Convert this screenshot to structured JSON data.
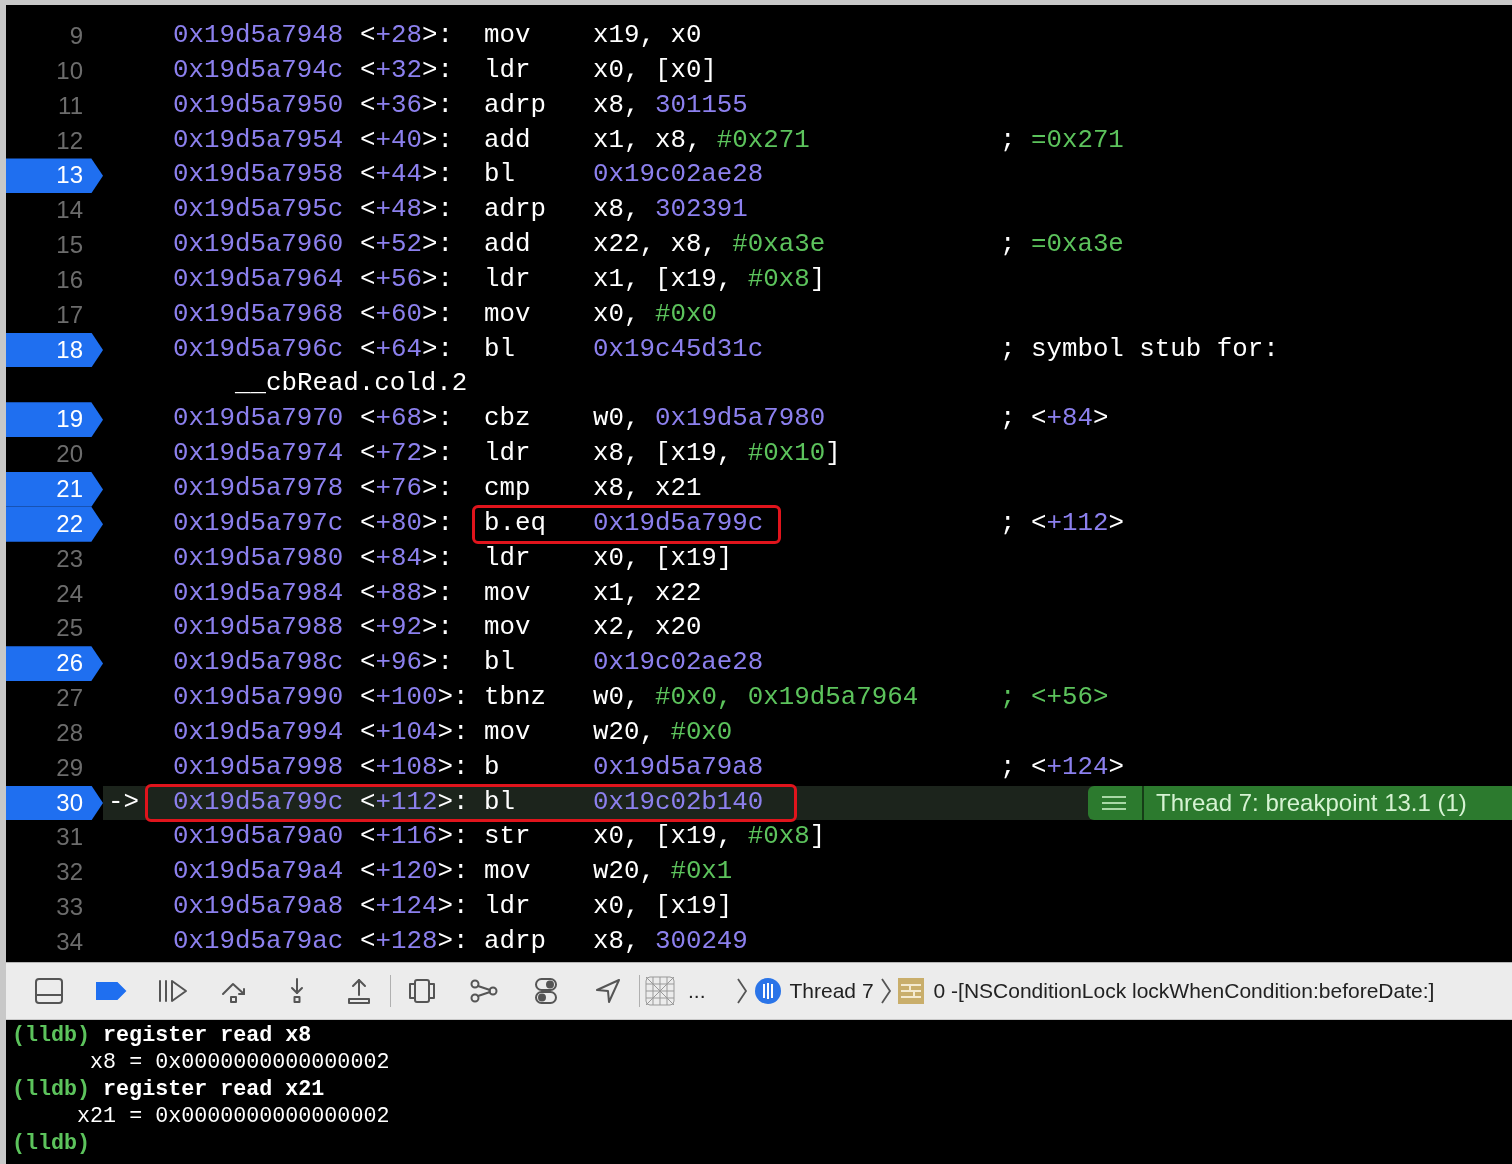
{
  "disassembly": {
    "rows": [
      {
        "line": "9",
        "breakpoint": false,
        "current": false,
        "address": "0x19d5a7948",
        "offset": "<+28>:",
        "mnemonic": "mov",
        "operands": [
          {
            "text": "x19, x0",
            "kind": "reg"
          }
        ]
      },
      {
        "line": "10",
        "breakpoint": false,
        "current": false,
        "address": "0x19d5a794c",
        "offset": "<+32>:",
        "mnemonic": "ldr",
        "operands": [
          {
            "text": "x0, [x0]",
            "kind": "reg"
          }
        ]
      },
      {
        "line": "11",
        "breakpoint": false,
        "current": false,
        "address": "0x19d5a7950",
        "offset": "<+36>:",
        "mnemonic": "adrp",
        "operands": [
          {
            "text": "x8, ",
            "kind": "reg"
          },
          {
            "text": "301155",
            "kind": "addr"
          }
        ]
      },
      {
        "line": "12",
        "breakpoint": false,
        "current": false,
        "address": "0x19d5a7954",
        "offset": "<+40>:",
        "mnemonic": "add",
        "operands": [
          {
            "text": "x1, x8, ",
            "kind": "reg"
          },
          {
            "text": "#0x271",
            "kind": "imm"
          }
        ],
        "comment": [
          {
            "text": "; ",
            "kind": "reg"
          },
          {
            "text": "=0x271",
            "kind": "imm"
          }
        ]
      },
      {
        "line": "13",
        "breakpoint": true,
        "current": false,
        "address": "0x19d5a7958",
        "offset": "<+44>:",
        "mnemonic": "bl",
        "operands": [
          {
            "text": "0x19c02ae28",
            "kind": "addr"
          }
        ]
      },
      {
        "line": "14",
        "breakpoint": false,
        "current": false,
        "address": "0x19d5a795c",
        "offset": "<+48>:",
        "mnemonic": "adrp",
        "operands": [
          {
            "text": "x8, ",
            "kind": "reg"
          },
          {
            "text": "302391",
            "kind": "addr"
          }
        ]
      },
      {
        "line": "15",
        "breakpoint": false,
        "current": false,
        "address": "0x19d5a7960",
        "offset": "<+52>:",
        "mnemonic": "add",
        "operands": [
          {
            "text": "x22, x8, ",
            "kind": "reg"
          },
          {
            "text": "#0xa3e",
            "kind": "imm"
          }
        ],
        "comment": [
          {
            "text": "; ",
            "kind": "reg"
          },
          {
            "text": "=0xa3e",
            "kind": "imm"
          }
        ]
      },
      {
        "line": "16",
        "breakpoint": false,
        "current": false,
        "address": "0x19d5a7964",
        "offset": "<+56>:",
        "mnemonic": "ldr",
        "operands": [
          {
            "text": "x1, [x19, ",
            "kind": "reg"
          },
          {
            "text": "#0x8",
            "kind": "imm"
          },
          {
            "text": "]",
            "kind": "reg"
          }
        ]
      },
      {
        "line": "17",
        "breakpoint": false,
        "current": false,
        "address": "0x19d5a7968",
        "offset": "<+60>:",
        "mnemonic": "mov",
        "operands": [
          {
            "text": "x0, ",
            "kind": "reg"
          },
          {
            "text": "#0x0",
            "kind": "imm"
          }
        ]
      },
      {
        "line": "18",
        "breakpoint": true,
        "current": false,
        "address": "0x19d5a796c",
        "offset": "<+64>:",
        "mnemonic": "bl",
        "operands": [
          {
            "text": "0x19c45d31c",
            "kind": "addr"
          }
        ],
        "comment": [
          {
            "text": "; symbol stub for:",
            "kind": "reg"
          }
        ],
        "continuation": "__cbRead.cold.2"
      },
      {
        "line": "19",
        "breakpoint": true,
        "current": false,
        "address": "0x19d5a7970",
        "offset": "<+68>:",
        "mnemonic": "cbz",
        "operands": [
          {
            "text": "w0, ",
            "kind": "reg"
          },
          {
            "text": "0x19d5a7980",
            "kind": "addr"
          }
        ],
        "comment": [
          {
            "text": "; <",
            "kind": "reg"
          },
          {
            "text": "+84",
            "kind": "addr"
          },
          {
            "text": ">",
            "kind": "reg"
          }
        ]
      },
      {
        "line": "20",
        "breakpoint": false,
        "current": false,
        "address": "0x19d5a7974",
        "offset": "<+72>:",
        "mnemonic": "ldr",
        "operands": [
          {
            "text": "x8, [x19, ",
            "kind": "reg"
          },
          {
            "text": "#0x10",
            "kind": "imm"
          },
          {
            "text": "]",
            "kind": "reg"
          }
        ]
      },
      {
        "line": "21",
        "breakpoint": true,
        "current": false,
        "address": "0x19d5a7978",
        "offset": "<+76>:",
        "mnemonic": "cmp",
        "operands": [
          {
            "text": "x8, x21",
            "kind": "reg"
          }
        ]
      },
      {
        "line": "22",
        "breakpoint": true,
        "current": false,
        "outline": {
          "kind": "instruction"
        },
        "address": "0x19d5a797c",
        "offset": "<+80>:",
        "mnemonic": "b.eq",
        "operands": [
          {
            "text": "0x19d5a799c",
            "kind": "addr"
          }
        ],
        "comment": [
          {
            "text": "; <",
            "kind": "reg"
          },
          {
            "text": "+112",
            "kind": "addr"
          },
          {
            "text": ">",
            "kind": "reg"
          }
        ]
      },
      {
        "line": "23",
        "breakpoint": false,
        "current": false,
        "address": "0x19d5a7980",
        "offset": "<+84>:",
        "mnemonic": "ldr",
        "operands": [
          {
            "text": "x0, [x19]",
            "kind": "reg"
          }
        ]
      },
      {
        "line": "24",
        "breakpoint": false,
        "current": false,
        "address": "0x19d5a7984",
        "offset": "<+88>:",
        "mnemonic": "mov",
        "operands": [
          {
            "text": "x1, x22",
            "kind": "reg"
          }
        ]
      },
      {
        "line": "25",
        "breakpoint": false,
        "current": false,
        "address": "0x19d5a7988",
        "offset": "<+92>:",
        "mnemonic": "mov",
        "operands": [
          {
            "text": "x2, x20",
            "kind": "reg"
          }
        ]
      },
      {
        "line": "26",
        "breakpoint": true,
        "current": false,
        "address": "0x19d5a798c",
        "offset": "<+96>:",
        "mnemonic": "bl",
        "operands": [
          {
            "text": "0x19c02ae28",
            "kind": "addr"
          }
        ]
      },
      {
        "line": "27",
        "breakpoint": false,
        "current": false,
        "address": "0x19d5a7990",
        "offset": "<+100>:",
        "mnemonic": "tbnz",
        "operands": [
          {
            "text": "w0, ",
            "kind": "reg"
          },
          {
            "text": "#0x0, 0x19d5a7964",
            "kind": "imm"
          }
        ],
        "comment": [
          {
            "text": "; <+56>",
            "kind": "imm"
          }
        ]
      },
      {
        "line": "28",
        "breakpoint": false,
        "current": false,
        "address": "0x19d5a7994",
        "offset": "<+104>:",
        "mnemonic": "mov",
        "operands": [
          {
            "text": "w20, ",
            "kind": "reg"
          },
          {
            "text": "#0x0",
            "kind": "imm"
          }
        ]
      },
      {
        "line": "29",
        "breakpoint": false,
        "current": false,
        "address": "0x19d5a7998",
        "offset": "<+108>:",
        "mnemonic": "b",
        "operands": [
          {
            "text": "0x19d5a79a8",
            "kind": "addr"
          }
        ],
        "comment": [
          {
            "text": "; <",
            "kind": "reg"
          },
          {
            "text": "+124",
            "kind": "addr"
          },
          {
            "text": ">",
            "kind": "reg"
          }
        ]
      },
      {
        "line": "30",
        "breakpoint": true,
        "current": true,
        "pc_marker": "->",
        "outline": {
          "kind": "line"
        },
        "address": "0x19d5a799c",
        "offset": "<+112>:",
        "mnemonic": "bl",
        "operands": [
          {
            "text": "0x19c02b140",
            "kind": "addr"
          }
        ],
        "annotation": "Thread 7: breakpoint 13.1 (1)"
      },
      {
        "line": "31",
        "breakpoint": false,
        "current": false,
        "address": "0x19d5a79a0",
        "offset": "<+116>:",
        "mnemonic": "str",
        "operands": [
          {
            "text": "x0, [x19, ",
            "kind": "reg"
          },
          {
            "text": "#0x8",
            "kind": "imm"
          },
          {
            "text": "]",
            "kind": "reg"
          }
        ]
      },
      {
        "line": "32",
        "breakpoint": false,
        "current": false,
        "address": "0x19d5a79a4",
        "offset": "<+120>:",
        "mnemonic": "mov",
        "operands": [
          {
            "text": "w20, ",
            "kind": "reg"
          },
          {
            "text": "#0x1",
            "kind": "imm"
          }
        ]
      },
      {
        "line": "33",
        "breakpoint": false,
        "current": false,
        "address": "0x19d5a79a8",
        "offset": "<+124>:",
        "mnemonic": "ldr",
        "operands": [
          {
            "text": "x0, [x19]",
            "kind": "reg"
          }
        ]
      },
      {
        "line": "34",
        "breakpoint": false,
        "current": false,
        "address": "0x19d5a79ac",
        "offset": "<+128>:",
        "mnemonic": "adrp",
        "operands": [
          {
            "text": "x8, ",
            "kind": "reg"
          },
          {
            "text": "300249",
            "kind": "addr"
          }
        ]
      }
    ]
  },
  "debug_bar": {
    "breakpoints_active": true,
    "more": "...",
    "thread": "Thread 7",
    "frame": "0 -[NSConditionLock lockWhenCondition:beforeDate:]"
  },
  "console": {
    "lines": [
      {
        "kind": "command",
        "prompt": "(lldb)",
        "text": "register read x8"
      },
      {
        "kind": "output",
        "text": "      x8 = 0x0000000000000002"
      },
      {
        "kind": "command",
        "prompt": "(lldb)",
        "text": "register read x21"
      },
      {
        "kind": "output",
        "text": "     x21 = 0x0000000000000002"
      },
      {
        "kind": "command",
        "prompt": "(lldb)"
      }
    ]
  }
}
